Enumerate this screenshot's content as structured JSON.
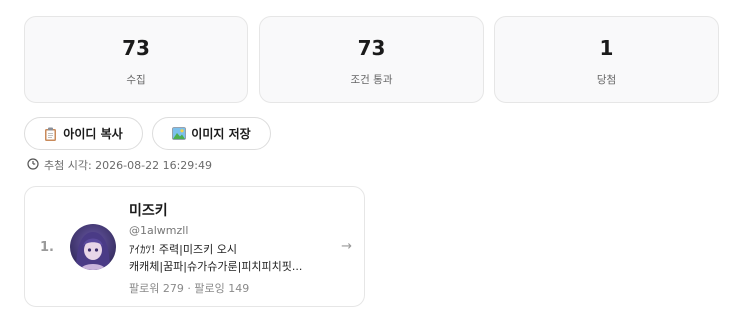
{
  "stats": [
    {
      "value": "73",
      "label": "수집"
    },
    {
      "value": "73",
      "label": "조건 통과"
    },
    {
      "value": "1",
      "label": "당첨"
    }
  ],
  "actions": {
    "copy_ids_label": "아이디 복사",
    "copy_ids_icon": "clipboard-icon",
    "save_image_label": "이미지 저장",
    "save_image_icon": "picture-icon"
  },
  "draw_time": {
    "icon": "clock-icon",
    "text": "추첨 시각: 2026-08-22 16:29:49"
  },
  "winners": [
    {
      "rank": "1.",
      "name": "미즈키",
      "handle": "@1alwmzll",
      "bio_line1": "ｱｲｶﾂ! 주력|미즈키 오시",
      "bio_line2": "캐캐체|꿈파|슈가슈가룬|피치피치핏...",
      "follow_stats": "팔로워 279 · 팔로잉 149",
      "arrow": "→"
    }
  ]
}
